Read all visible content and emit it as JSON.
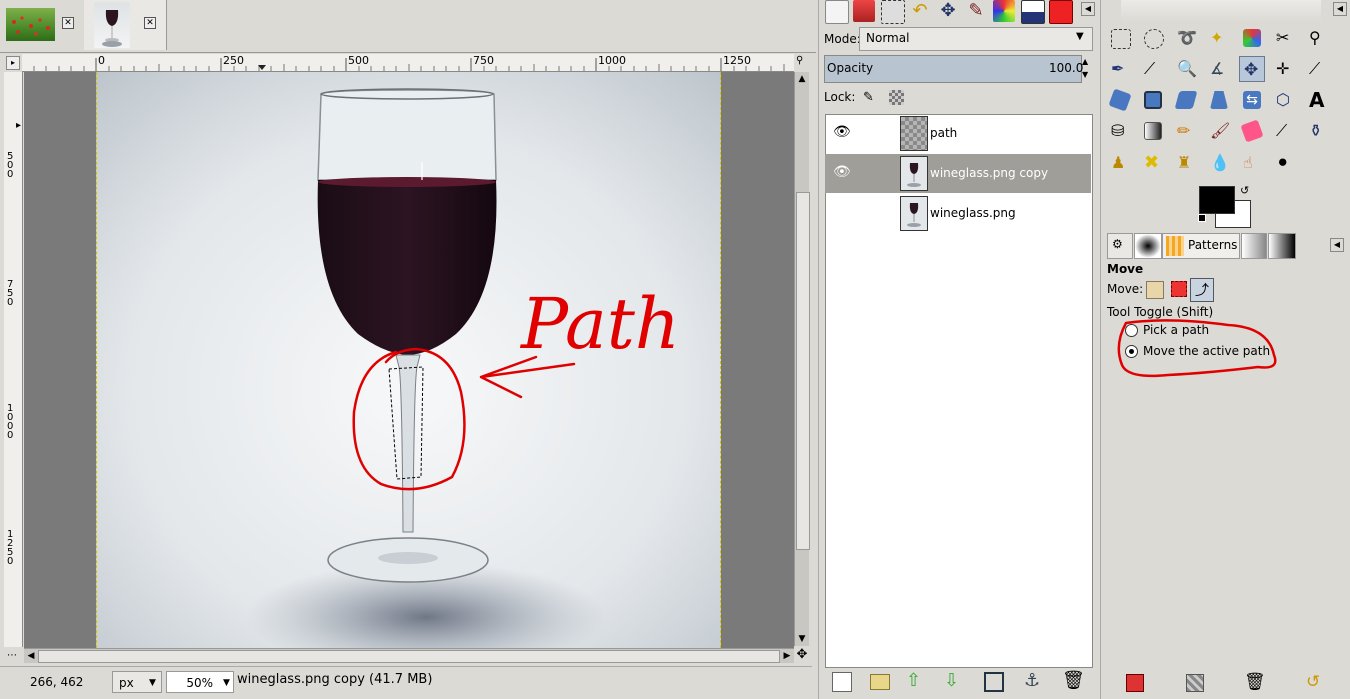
{
  "canvas": {
    "ruler_top_labels": [
      "0",
      "250",
      "500",
      "750",
      "1000",
      "1250"
    ],
    "ruler_left_labels": [
      "500",
      "750",
      "1000",
      "1250"
    ],
    "annotation_text": "Path"
  },
  "status": {
    "coords": "266, 462",
    "unit": "px",
    "zoom": "50%",
    "image_info": "wineglass.png copy (41.7 MB)"
  },
  "layers_panel": {
    "mode_label": "Mode:",
    "mode_value": "Normal",
    "opacity_label": "Opacity",
    "opacity_value": "100.0",
    "lock_label": "Lock:",
    "layers": [
      {
        "name": "path",
        "visible": true,
        "selected": false
      },
      {
        "name": "wineglass.png copy",
        "visible": true,
        "selected": true
      },
      {
        "name": "wineglass.png",
        "visible": false,
        "selected": false
      }
    ]
  },
  "toolbox": {
    "tabs": [
      "Patterns"
    ],
    "options": {
      "title": "Move",
      "move_label": "Move:",
      "toggle_label": "Tool Toggle  (Shift)",
      "radio_options": [
        {
          "label": "Pick a path",
          "checked": false
        },
        {
          "label": "Move the active path",
          "checked": true
        }
      ]
    }
  },
  "colors": {
    "annotation": "#e00000",
    "selected_layer": "#a09e98",
    "panel_bg": "#dcdad5"
  }
}
